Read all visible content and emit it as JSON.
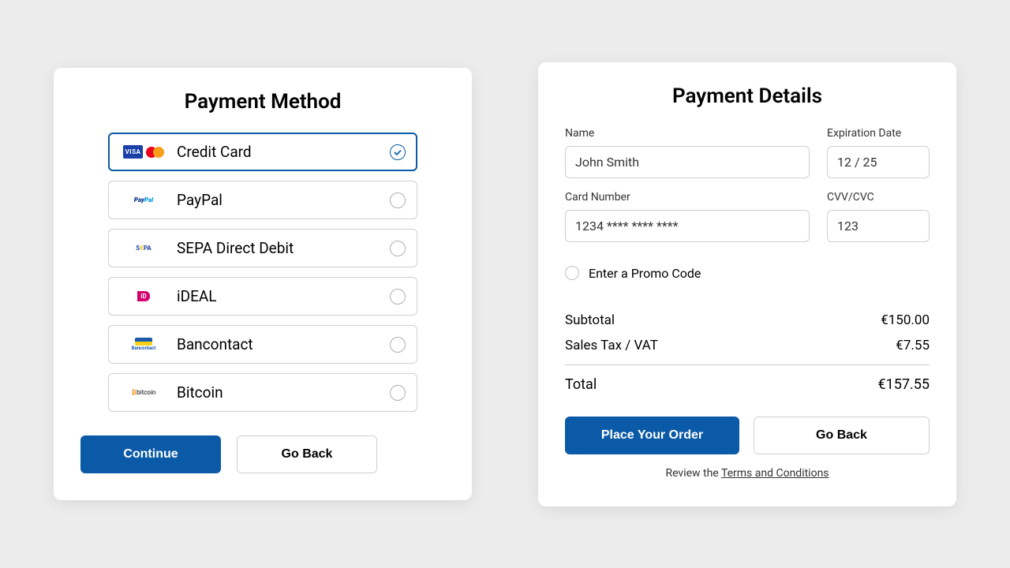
{
  "left": {
    "title": "Payment Method",
    "options": [
      {
        "label": "Credit Card",
        "selected": true
      },
      {
        "label": "PayPal",
        "selected": false
      },
      {
        "label": "SEPA Direct Debit",
        "selected": false
      },
      {
        "label": "iDEAL",
        "selected": false
      },
      {
        "label": "Bancontact",
        "selected": false
      },
      {
        "label": "Bitcoin",
        "selected": false
      }
    ],
    "continue": "Continue",
    "goback": "Go Back"
  },
  "right": {
    "title": "Payment Details",
    "fields": {
      "name_label": "Name",
      "name_value": "John Smith",
      "exp_label": "Expiration Date",
      "exp_value": "12 / 25",
      "card_label": "Card Number",
      "card_value": "1234 **** **** ****",
      "cvv_label": "CVV/CVC",
      "cvv_value": "123"
    },
    "promo": "Enter a Promo Code",
    "subtotal_label": "Subtotal",
    "subtotal_value": "€150.00",
    "tax_label": "Sales Tax / VAT",
    "tax_value": "€7.55",
    "total_label": "Total",
    "total_value": "€157.55",
    "place": "Place Your Order",
    "goback": "Go Back",
    "terms_prefix": "Review the ",
    "terms_link": "Terms and Conditions"
  }
}
